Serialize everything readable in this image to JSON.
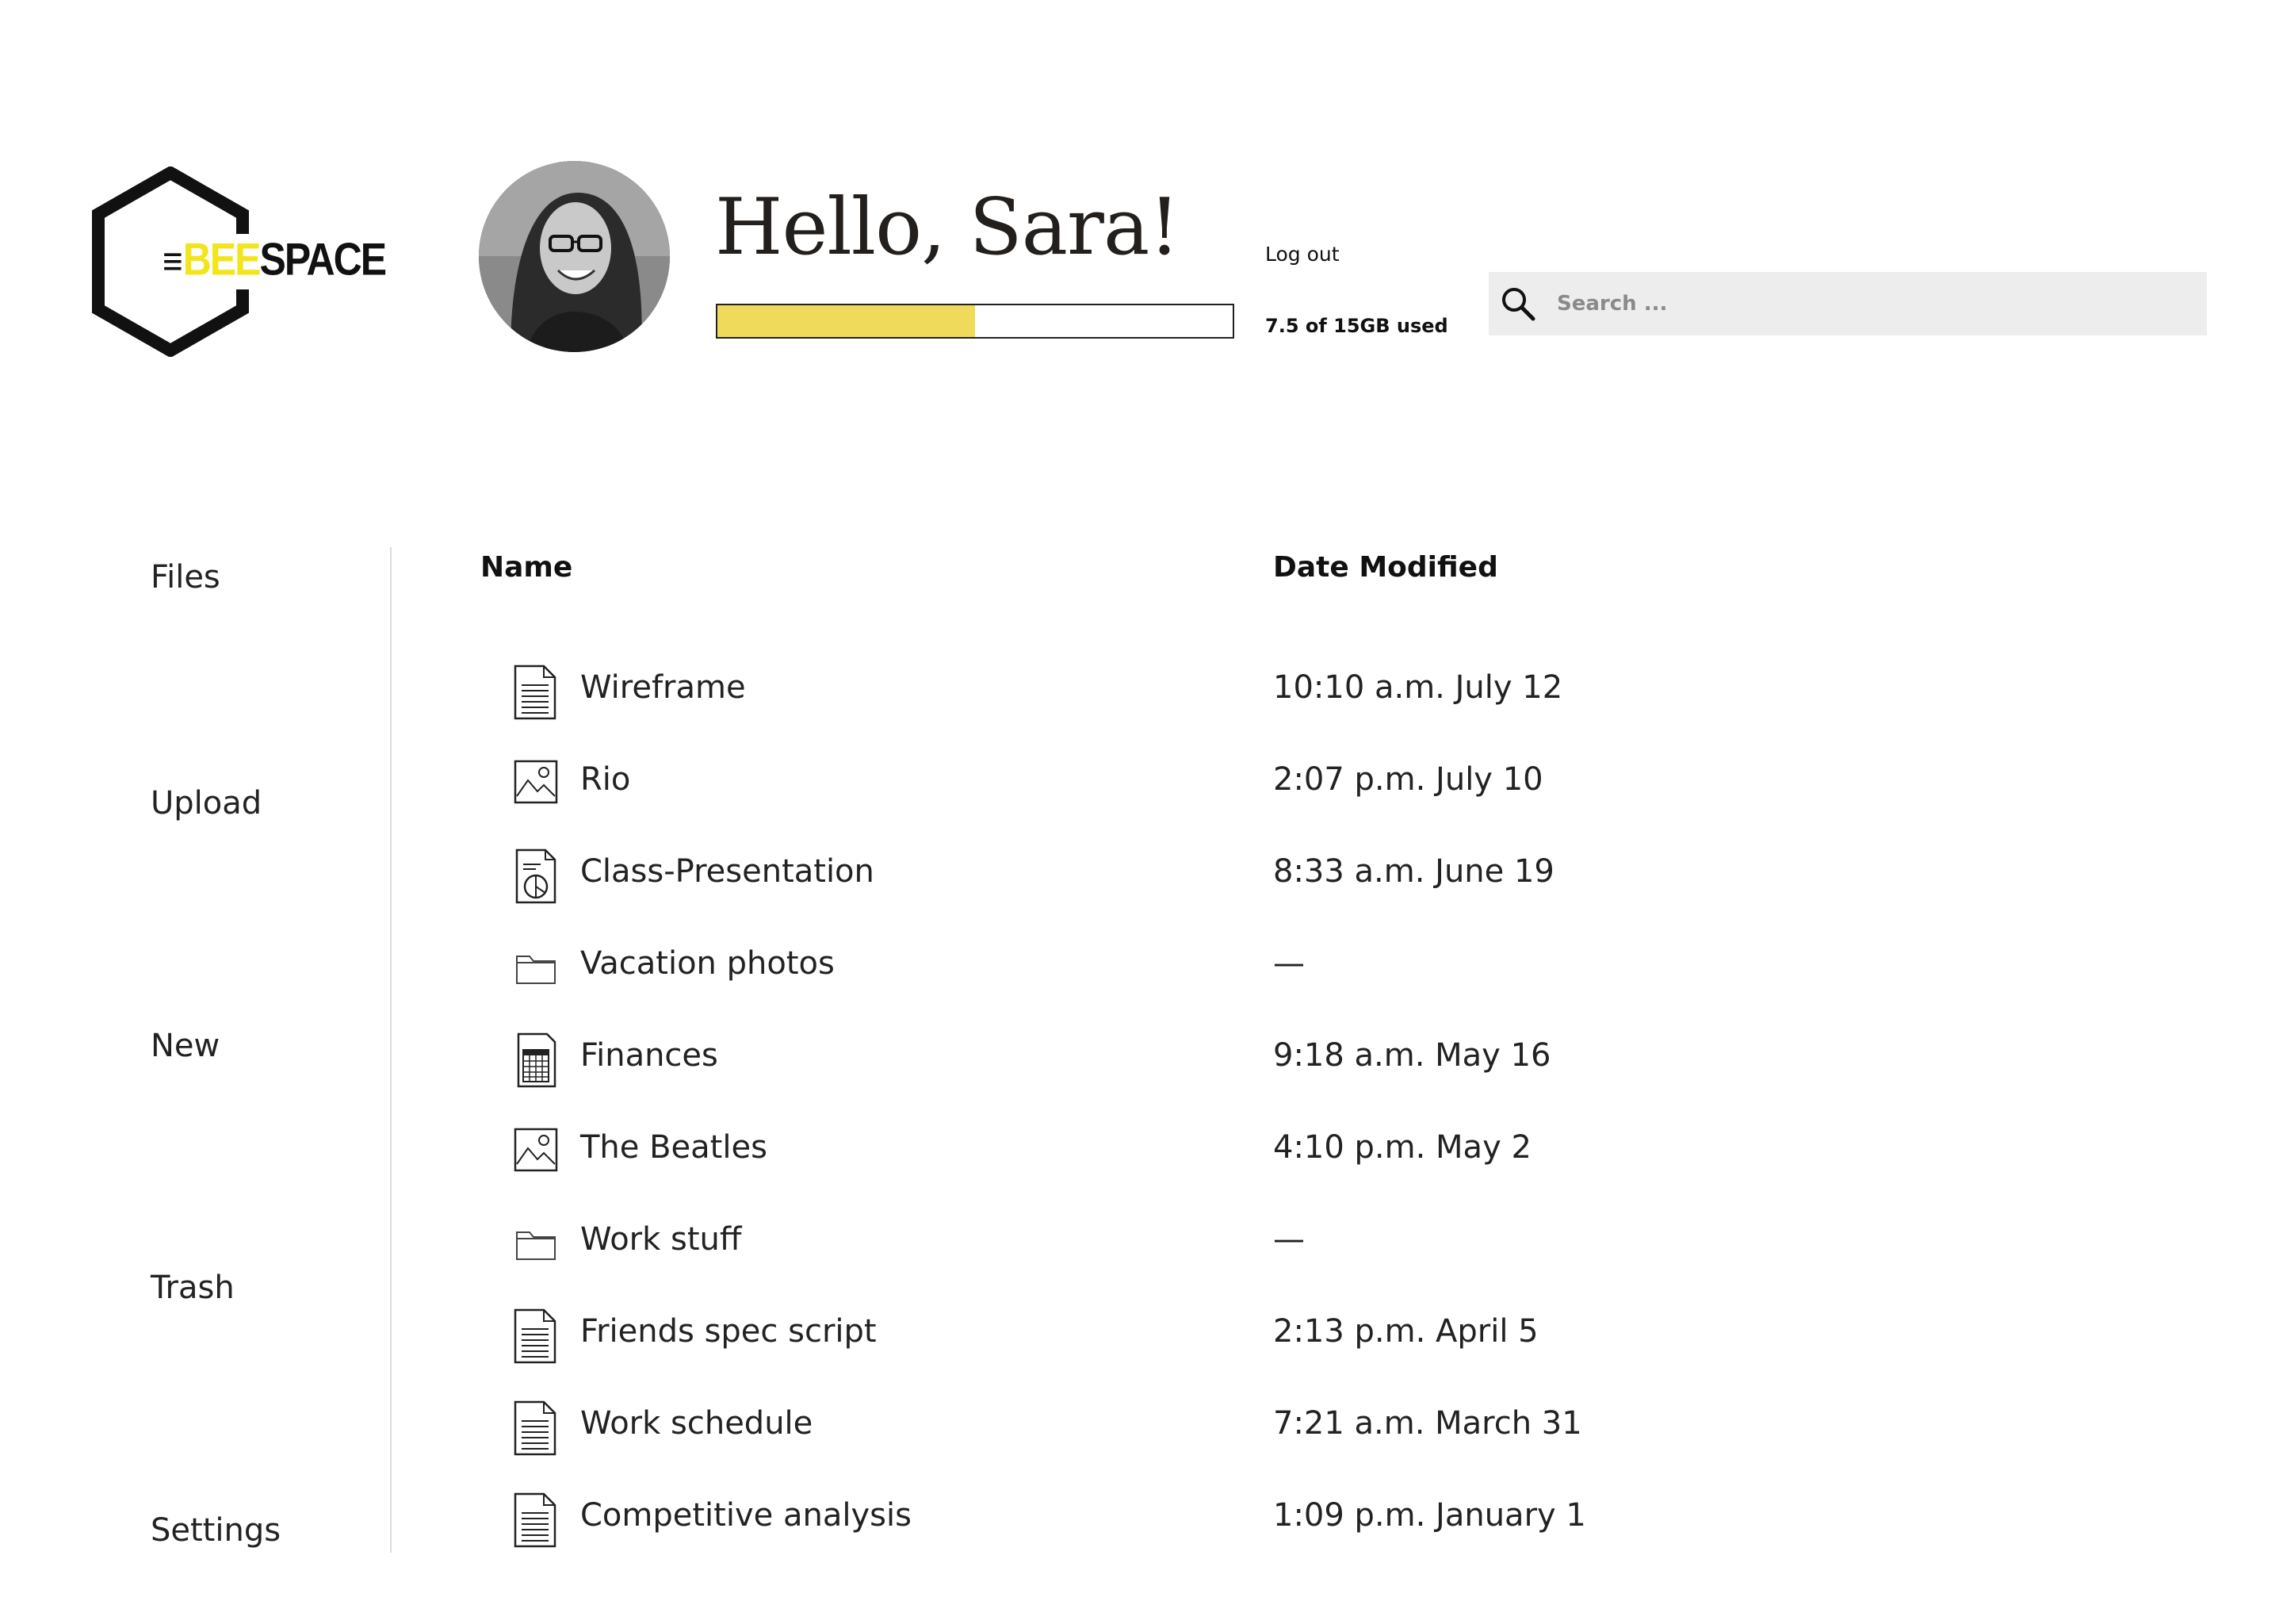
{
  "brand": {
    "menu_glyph": "≡",
    "name_part1": "BEE",
    "name_part2": "SPACE",
    "accent_color": "#f2e51b"
  },
  "header": {
    "greeting": "Hello, Sara!",
    "logout_label": "Log out",
    "storage": {
      "used_text": "7.5 of 15GB used",
      "used_fraction": 0.5,
      "fill_color": "#f0da5c"
    },
    "search": {
      "placeholder": "Search ..."
    }
  },
  "sidebar": {
    "items": [
      {
        "label": "Files"
      },
      {
        "label": "Upload"
      },
      {
        "label": "New"
      },
      {
        "label": "Trash"
      },
      {
        "label": "Settings"
      }
    ]
  },
  "table": {
    "columns": {
      "name": "Name",
      "date": "Date Modified"
    },
    "rows": [
      {
        "icon": "document-icon",
        "name": "Wireframe",
        "date": "10:10 a.m. July 12"
      },
      {
        "icon": "image-icon",
        "name": "Rio",
        "date": "2:07 p.m. July 10"
      },
      {
        "icon": "presentation-icon",
        "name": "Class-Presentation",
        "date": "8:33 a.m. June 19"
      },
      {
        "icon": "folder-icon",
        "name": "Vacation photos",
        "date": "—"
      },
      {
        "icon": "spreadsheet-icon",
        "name": "Finances",
        "date": "9:18 a.m. May 16"
      },
      {
        "icon": "image-icon",
        "name": "The Beatles",
        "date": "4:10 p.m. May 2"
      },
      {
        "icon": "folder-icon",
        "name": "Work stuff",
        "date": "—"
      },
      {
        "icon": "document-icon",
        "name": "Friends spec script",
        "date": "2:13 p.m. April 5"
      },
      {
        "icon": "document-icon",
        "name": "Work schedule",
        "date": "7:21 a.m. March 31"
      },
      {
        "icon": "document-icon",
        "name": "Competitive analysis",
        "date": "1:09 p.m. January 1"
      }
    ]
  }
}
